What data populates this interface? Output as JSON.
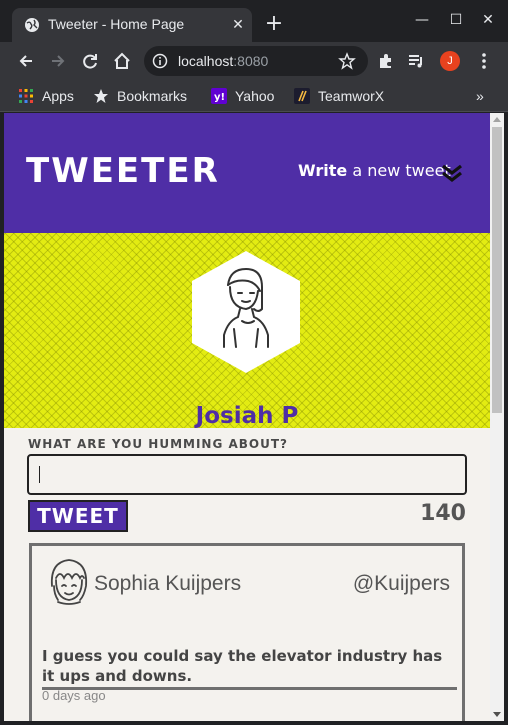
{
  "browser": {
    "tab_title": "Tweeter - Home Page",
    "url_host": "localhost",
    "url_port": ":8080",
    "profile_initial": "J",
    "bookmarks": [
      {
        "label": "Apps",
        "icon": "apps-grid-icon"
      },
      {
        "label": "Bookmarks",
        "icon": "star-icon"
      },
      {
        "label": "Yahoo",
        "icon": "yahoo-icon"
      },
      {
        "label": "TeamworX",
        "icon": "teamworx-icon"
      }
    ],
    "more_bookmarks": "»"
  },
  "header": {
    "logo": "TWEETER",
    "write_bold": "Write",
    "write_rest": "a new tweet"
  },
  "profile": {
    "name": "Josiah P"
  },
  "compose": {
    "label": "WHAT ARE YOU HUMMING ABOUT?",
    "value": "",
    "button": "TWEET",
    "counter": "140"
  },
  "tweets": [
    {
      "name": "Sophia Kuijpers",
      "handle": "@Kuijpers",
      "text": "I guess you could say the elevator industry has it ups and downs.",
      "time": "0 days ago"
    }
  ],
  "colors": {
    "brand_purple": "#4f2ea6",
    "banner_yellow": "#e3ec12",
    "page_bg": "#f4f2ee"
  }
}
